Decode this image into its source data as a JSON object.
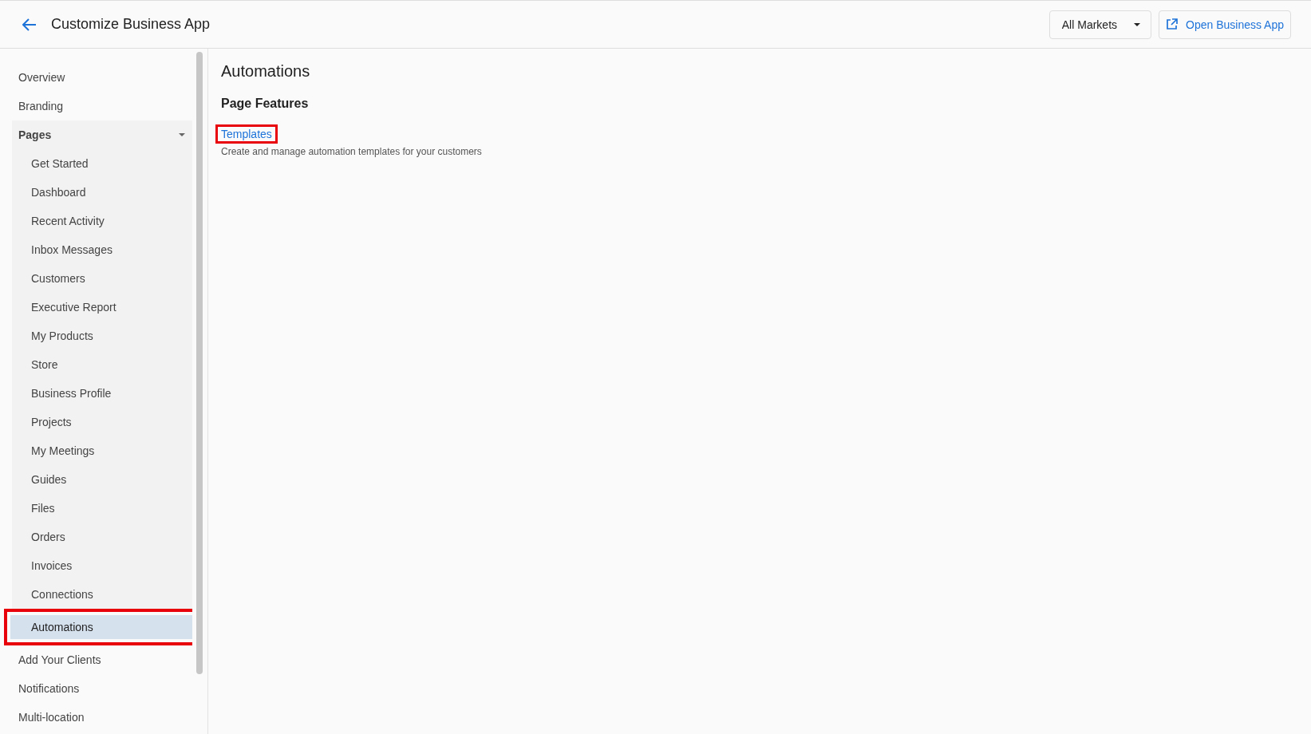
{
  "header": {
    "title": "Customize Business App",
    "market_dropdown": {
      "label": "All Markets"
    },
    "open_button": {
      "label": "Open Business App"
    }
  },
  "sidebar": {
    "items": [
      {
        "label": "Overview",
        "selected": false,
        "highlighted": false
      },
      {
        "label": "Branding",
        "selected": false,
        "highlighted": false
      },
      {
        "label": "Pages",
        "selected": false,
        "highlighted": false,
        "expanded": true,
        "children": [
          {
            "label": "Get Started",
            "selected": false,
            "highlighted": false
          },
          {
            "label": "Dashboard",
            "selected": false,
            "highlighted": false
          },
          {
            "label": "Recent Activity",
            "selected": false,
            "highlighted": false
          },
          {
            "label": "Inbox Messages",
            "selected": false,
            "highlighted": false
          },
          {
            "label": "Customers",
            "selected": false,
            "highlighted": false
          },
          {
            "label": "Executive Report",
            "selected": false,
            "highlighted": false
          },
          {
            "label": "My Products",
            "selected": false,
            "highlighted": false
          },
          {
            "label": "Store",
            "selected": false,
            "highlighted": false
          },
          {
            "label": "Business Profile",
            "selected": false,
            "highlighted": false
          },
          {
            "label": "Projects",
            "selected": false,
            "highlighted": false
          },
          {
            "label": "My Meetings",
            "selected": false,
            "highlighted": false
          },
          {
            "label": "Guides",
            "selected": false,
            "highlighted": false
          },
          {
            "label": "Files",
            "selected": false,
            "highlighted": false
          },
          {
            "label": "Orders",
            "selected": false,
            "highlighted": false
          },
          {
            "label": "Invoices",
            "selected": false,
            "highlighted": false
          },
          {
            "label": "Connections",
            "selected": false,
            "highlighted": false
          },
          {
            "label": "Automations",
            "selected": true,
            "highlighted": true
          }
        ]
      },
      {
        "label": "Add Your Clients",
        "selected": false,
        "highlighted": false
      },
      {
        "label": "Notifications",
        "selected": false,
        "highlighted": false
      },
      {
        "label": "Multi-location",
        "selected": false,
        "highlighted": false
      }
    ]
  },
  "content": {
    "title": "Automations",
    "section_title": "Page Features",
    "features": [
      {
        "link": "Templates",
        "description": "Create and manage automation templates for your customers",
        "highlighted": true
      }
    ]
  }
}
